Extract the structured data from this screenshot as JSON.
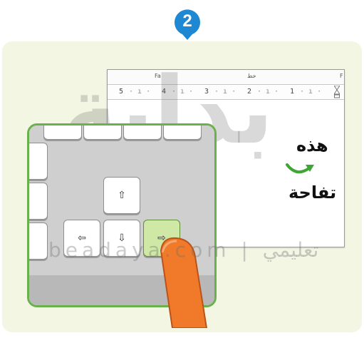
{
  "step": {
    "number": "2",
    "color": "#1e88d2"
  },
  "colors": {
    "panel": "#f2f6e3",
    "frame": "#6ab04c",
    "pressed_key": "#cfe8a6",
    "finger": "#f07a2a"
  },
  "word_window": {
    "ruler_top_labels": [
      "Fa",
      "خط",
      "F"
    ],
    "ruler_numbers": [
      "5",
      "4",
      "3",
      "2",
      "1"
    ],
    "document_text": {
      "line1": "هذه",
      "line2": "تفاحة"
    }
  },
  "keyboard": {
    "keys": {
      "up": "⇧",
      "left": "⇦",
      "down": "⇩",
      "right": "⇨"
    },
    "pressed": "right"
  },
  "watermark": {
    "logo": "بداية",
    "site": "beadaya.com | تعليمي"
  }
}
